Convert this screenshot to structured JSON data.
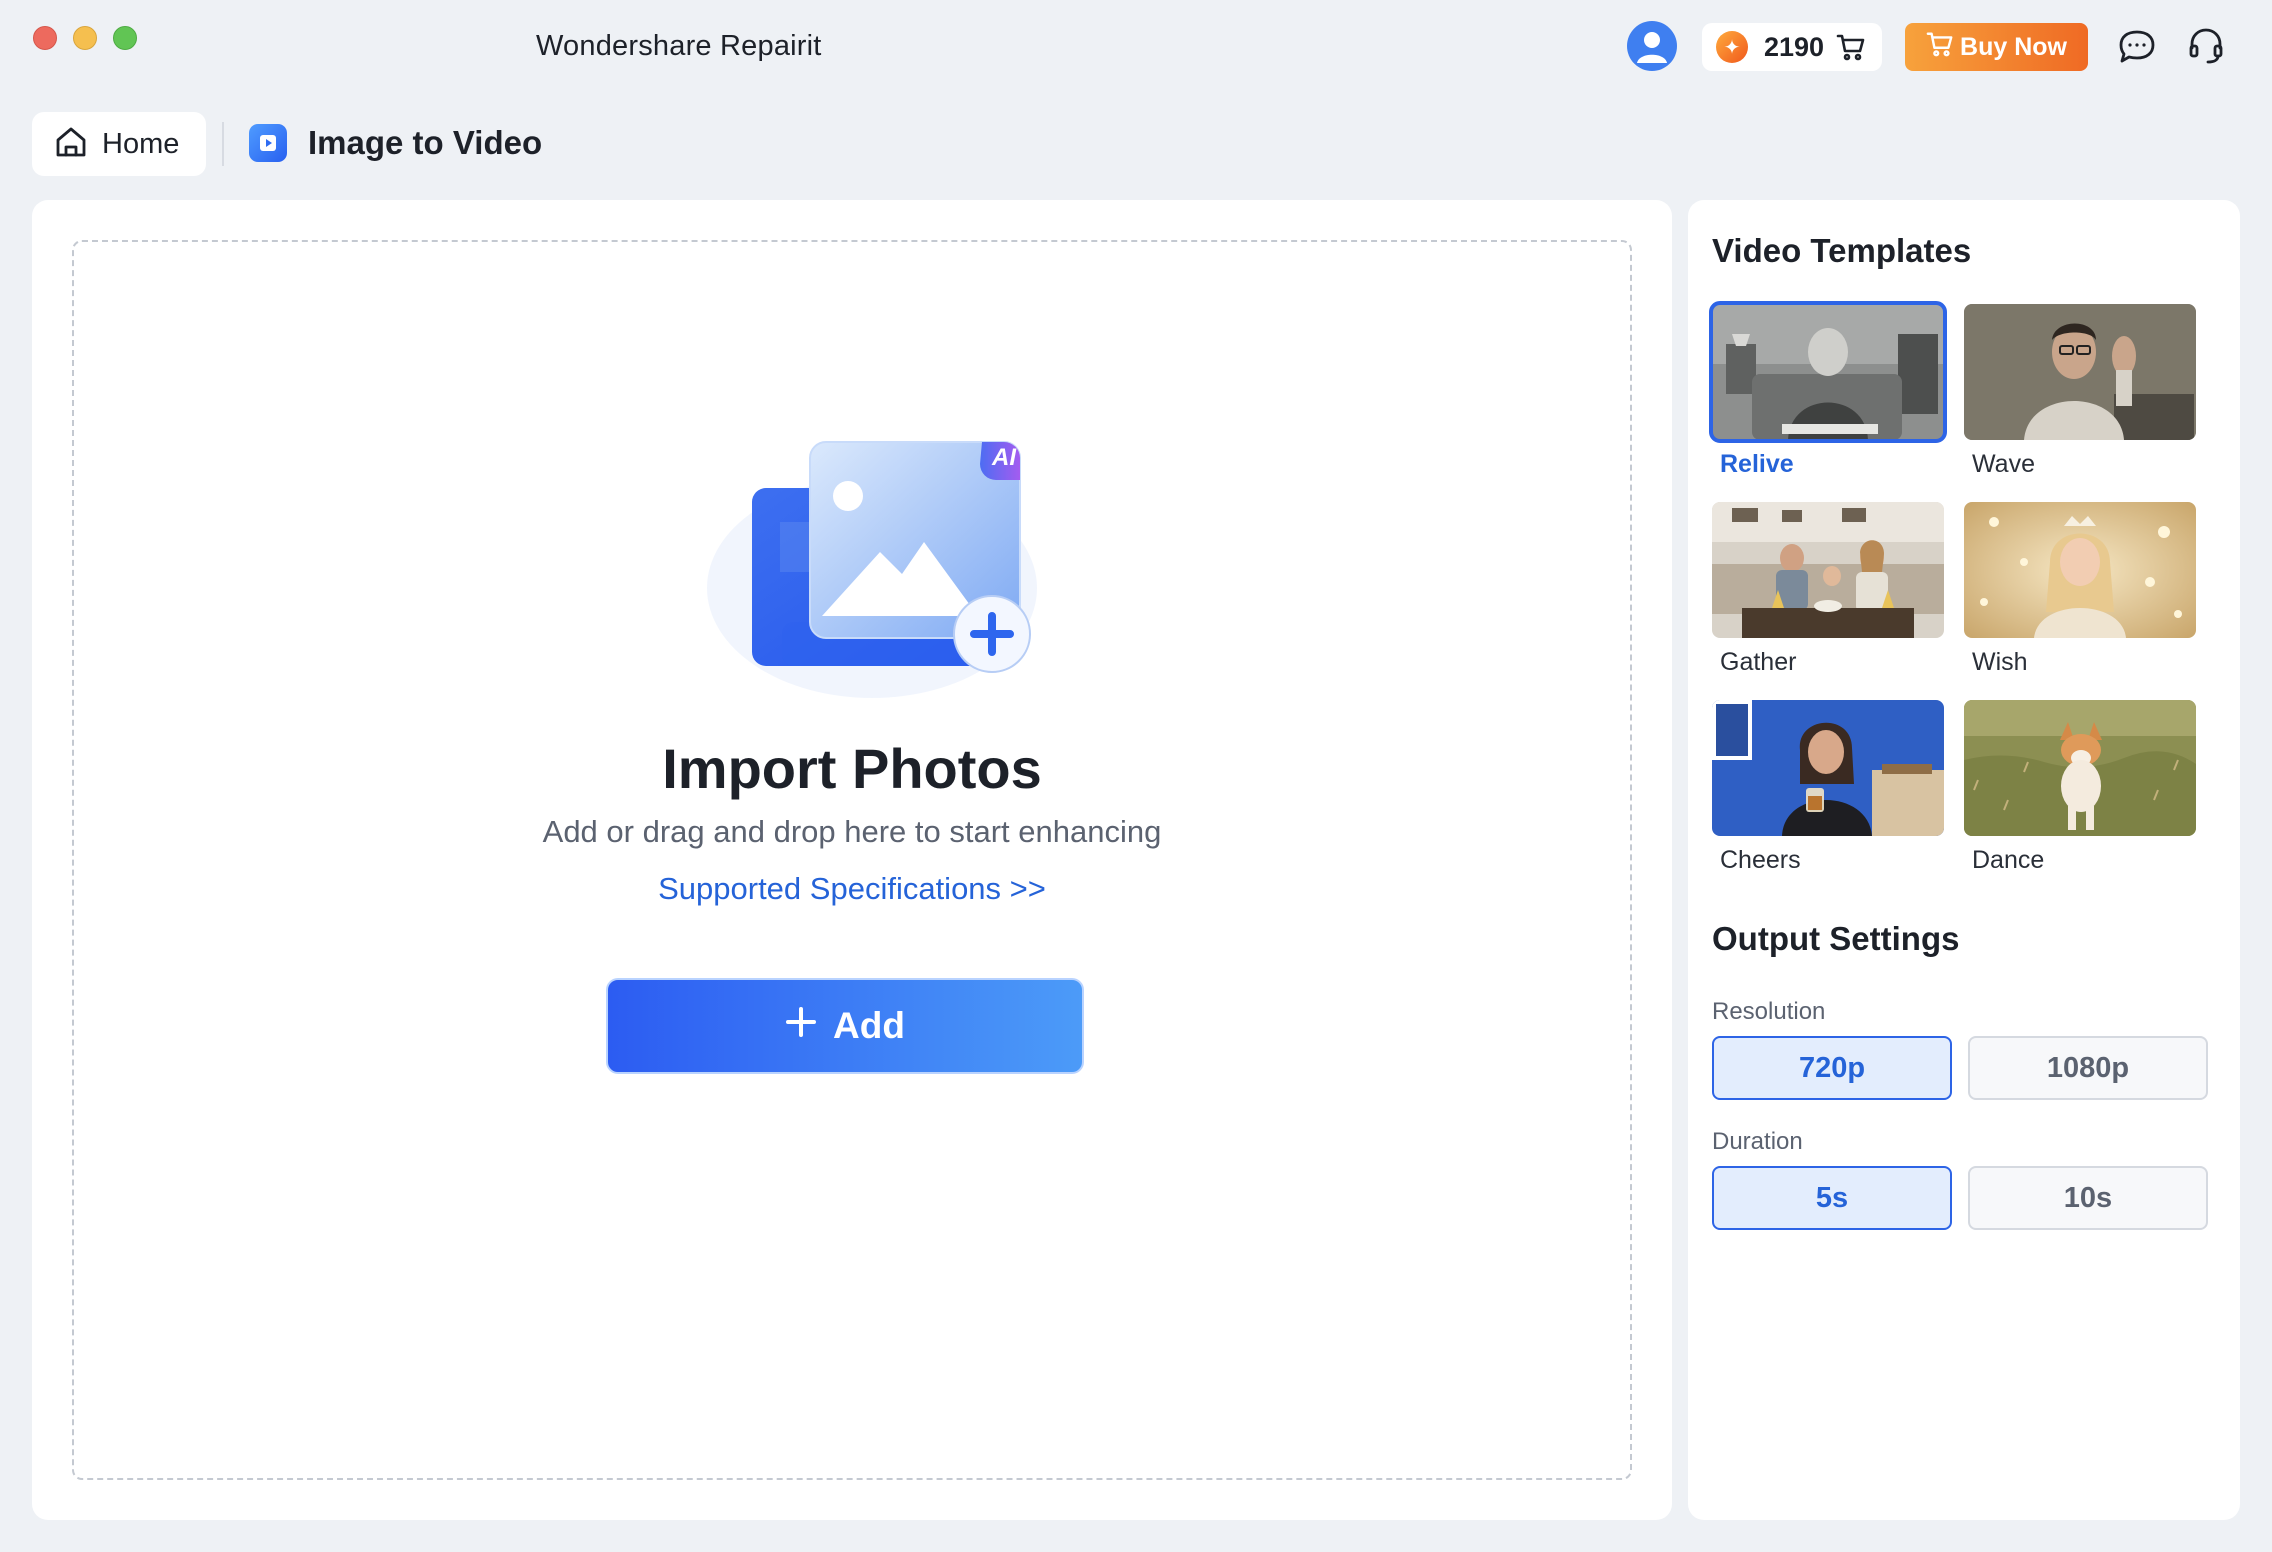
{
  "app": {
    "title": "Wondershare Repairit"
  },
  "header": {
    "credits": "2190",
    "buy_label": "Buy Now",
    "brand_colors": {
      "buy_start": "#f7a23c",
      "buy_end": "#ef6a24",
      "accent": "#2d64e6"
    }
  },
  "nav": {
    "home_label": "Home",
    "page_title": "Image to Video"
  },
  "import": {
    "badge": "AI",
    "title": "Import Photos",
    "subtitle": "Add or drag and drop here to start enhancing",
    "spec_link": "Supported Specifications >>",
    "add_label": "Add"
  },
  "templates": {
    "title": "Video Templates",
    "selected": "Relive",
    "items": [
      {
        "label": "Relive",
        "selected": true
      },
      {
        "label": "Wave",
        "selected": false
      },
      {
        "label": "Gather",
        "selected": false
      },
      {
        "label": "Wish",
        "selected": false
      },
      {
        "label": "Cheers",
        "selected": false
      },
      {
        "label": "Dance",
        "selected": false
      }
    ]
  },
  "output": {
    "title": "Output Settings",
    "resolution": {
      "label": "Resolution",
      "options": [
        "720p",
        "1080p"
      ],
      "selected": "720p"
    },
    "duration": {
      "label": "Duration",
      "options": [
        "5s",
        "10s"
      ],
      "selected": "5s"
    }
  }
}
